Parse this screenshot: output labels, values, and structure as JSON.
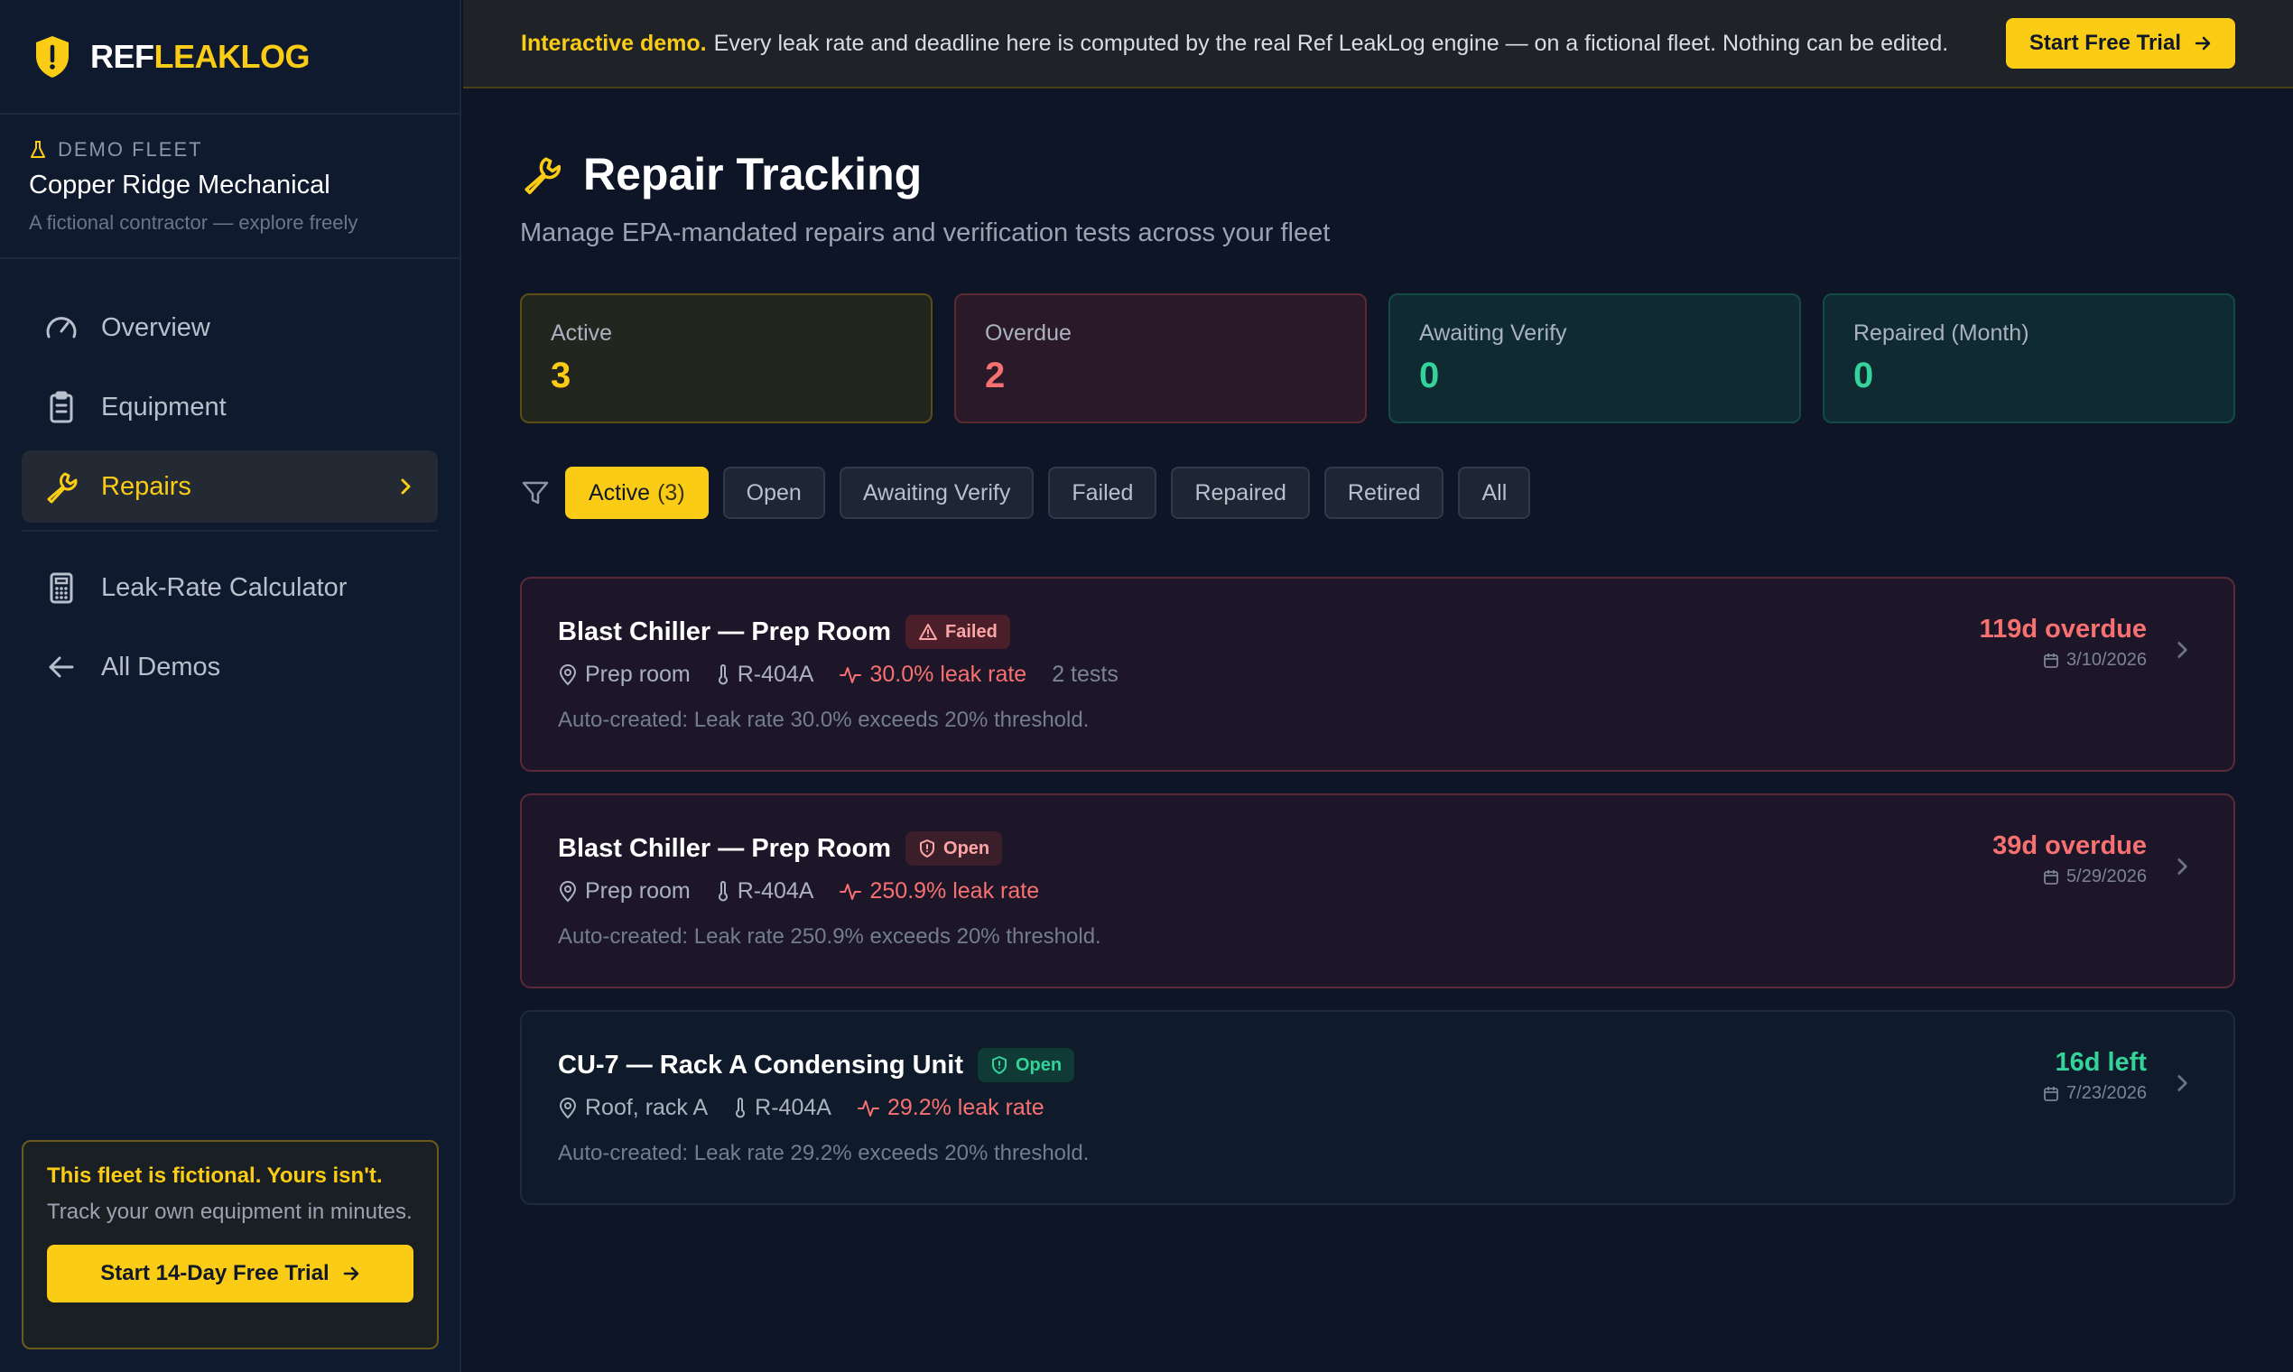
{
  "brand": {
    "part1": "REF",
    "part2": "LEAKLOG"
  },
  "fleet": {
    "tag": "DEMO FLEET",
    "name": "Copper Ridge Mechanical",
    "description": "A fictional contractor — explore freely"
  },
  "nav": {
    "overview": "Overview",
    "equipment": "Equipment",
    "repairs": "Repairs",
    "calculator": "Leak-Rate Calculator",
    "all_demos": "All Demos"
  },
  "promo": {
    "title": "This fleet is fictional. Yours isn't.",
    "text": "Track your own equipment in minutes.",
    "button": "Start 14-Day Free Trial"
  },
  "banner": {
    "emphasis": "Interactive demo.",
    "text": "Every leak rate and deadline here is computed by the real Ref LeakLog engine — on a fictional fleet. Nothing can be edited.",
    "button": "Start Free Trial"
  },
  "page": {
    "title": "Repair Tracking",
    "subtitle": "Manage EPA-mandated repairs and verification tests across your fleet"
  },
  "stats": [
    {
      "label": "Active",
      "value": "3"
    },
    {
      "label": "Overdue",
      "value": "2"
    },
    {
      "label": "Awaiting Verify",
      "value": "0"
    },
    {
      "label": "Repaired (Month)",
      "value": "0"
    }
  ],
  "filters": {
    "active": "Active",
    "active_count": "(3)",
    "open": "Open",
    "awaiting": "Awaiting Verify",
    "failed": "Failed",
    "repaired": "Repaired",
    "retired": "Retired",
    "all": "All"
  },
  "repairs": [
    {
      "title": "Blast Chiller — Prep Room",
      "badge": "Failed",
      "location": "Prep room",
      "refrigerant": "R-404A",
      "leak_rate": "30.0% leak rate",
      "tests": "2 tests",
      "note": "Auto-created: Leak rate 30.0% exceeds 20% threshold.",
      "status": "119d overdue",
      "date": "3/10/2026"
    },
    {
      "title": "Blast Chiller — Prep Room",
      "badge": "Open",
      "location": "Prep room",
      "refrigerant": "R-404A",
      "leak_rate": "250.9% leak rate",
      "note": "Auto-created: Leak rate 250.9% exceeds 20% threshold.",
      "status": "39d overdue",
      "date": "5/29/2026"
    },
    {
      "title": "CU-7 — Rack A Condensing Unit",
      "badge": "Open",
      "location": "Roof, rack A",
      "refrigerant": "R-404A",
      "leak_rate": "29.2% leak rate",
      "note": "Auto-created: Leak rate 29.2% exceeds 20% threshold.",
      "status": "16d left",
      "date": "7/23/2026"
    }
  ],
  "colors": {
    "accent": "#facc15",
    "danger": "#f87171",
    "success": "#34d399",
    "background": "#0d1526"
  },
  "icons": [
    "shield-alert-icon",
    "flask-icon",
    "gauge-icon",
    "clipboard-icon",
    "wrench-icon",
    "chevron-right-icon",
    "calculator-icon",
    "arrow-left-icon",
    "arrow-right-icon",
    "filter-icon",
    "warning-icon",
    "shield-icon",
    "map-pin-icon",
    "thermometer-icon",
    "activity-icon",
    "calendar-icon"
  ]
}
